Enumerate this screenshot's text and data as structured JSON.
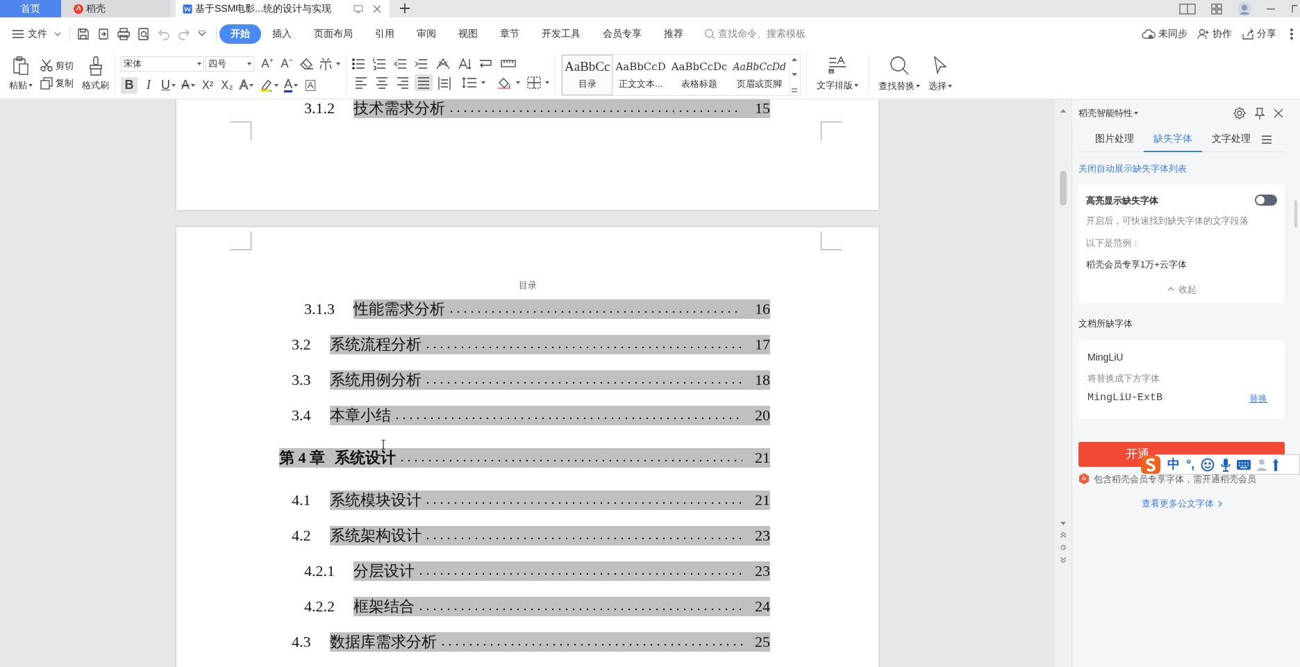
{
  "top_tabs": [
    {
      "kind": "home",
      "label": "首页",
      "selected": false
    },
    {
      "kind": "app",
      "label": "稻壳",
      "selected": false
    },
    {
      "kind": "doc",
      "label": "基于SSM电影...统的设计与实现",
      "selected": true
    }
  ],
  "menu": {
    "file": "文件",
    "tabs": [
      {
        "label": "开始",
        "selected": true
      },
      {
        "label": "插入",
        "selected": false
      },
      {
        "label": "页面布局",
        "selected": false
      },
      {
        "label": "引用",
        "selected": false
      },
      {
        "label": "审阅",
        "selected": false
      },
      {
        "label": "视图",
        "selected": false
      },
      {
        "label": "章节",
        "selected": false
      },
      {
        "label": "开发工具",
        "selected": false
      },
      {
        "label": "会员专享",
        "selected": false
      },
      {
        "label": "推荐",
        "selected": false
      }
    ],
    "search_placeholder": "查找命令、搜索模板",
    "actions": [
      {
        "kind": "sync",
        "label": "未同步"
      },
      {
        "kind": "collab",
        "label": "协作"
      },
      {
        "kind": "share",
        "label": "分享"
      }
    ]
  },
  "ribbon": {
    "paste": "粘贴",
    "cut": "剪切",
    "copy": "复制",
    "format_painter": "格式刷",
    "font": "宋体",
    "size": "四号",
    "grow": "A⁺",
    "shrink": "A⁻",
    "font_buttons": [
      {
        "kind": "bold",
        "label": "B",
        "selected": true
      },
      {
        "kind": "italic",
        "label": "I",
        "selected": false
      },
      {
        "kind": "underline",
        "label": "U",
        "selected": false
      },
      {
        "kind": "strike",
        "label": "A",
        "selected": false
      },
      {
        "kind": "sup",
        "label": "X²",
        "selected": false
      },
      {
        "kind": "sub",
        "label": "X₂",
        "selected": false
      },
      {
        "kind": "outline",
        "label": "A",
        "selected": false
      },
      {
        "kind": "highlight",
        "selected": false
      },
      {
        "kind": "color",
        "label": "A",
        "selected": false
      },
      {
        "kind": "boxed",
        "label": "A",
        "selected": false
      }
    ],
    "alignment": [
      {
        "kind": "left",
        "selected": false
      },
      {
        "kind": "center",
        "selected": false
      },
      {
        "kind": "right",
        "selected": false
      },
      {
        "kind": "justify",
        "selected": true
      },
      {
        "kind": "distribute",
        "selected": false
      }
    ],
    "styles": [
      {
        "sample": "AaBbCc",
        "label": "目录",
        "selected": true
      },
      {
        "sample": "AaBbCcD",
        "label": "正文文本...",
        "selected": false
      },
      {
        "sample": "AaBbCcDc",
        "label": "表格标题",
        "selected": false
      },
      {
        "sample": "AaBbCcDd",
        "label": "页眉或页脚",
        "selected": false
      }
    ],
    "text_layout": "文字排版",
    "find_replace": "查找替换",
    "select": "选择"
  },
  "document": {
    "pages": [
      {
        "entries": [
          {
            "kind": "subsection",
            "number": "3.1.2",
            "title": "技术需求分析",
            "page": "15"
          }
        ]
      },
      {
        "header": "目录",
        "entries": [
          {
            "kind": "subsection",
            "number": "3.1.3",
            "title": "性能需求分析",
            "page": "16"
          },
          {
            "kind": "section",
            "number": "3.2",
            "title": "系统流程分析",
            "page": "17"
          },
          {
            "kind": "section",
            "number": "3.3",
            "title": "系统用例分析",
            "page": "18"
          },
          {
            "kind": "section",
            "number": "3.4",
            "title": "本章小结",
            "page": "20"
          },
          {
            "kind": "chapter",
            "number": "第 4 章",
            "title": "系统设计",
            "page": "21"
          },
          {
            "kind": "section",
            "number": "4.1",
            "title": "系统模块设计",
            "page": "21"
          },
          {
            "kind": "section",
            "number": "4.2",
            "title": "系统架构设计",
            "page": "23"
          },
          {
            "kind": "subsection",
            "number": "4.2.1",
            "title": "分层设计",
            "page": "23"
          },
          {
            "kind": "subsection",
            "number": "4.2.2",
            "title": "框架结合",
            "page": "24"
          },
          {
            "kind": "section",
            "number": "4.3",
            "title": "数据库需求分析",
            "page": "25"
          }
        ]
      }
    ]
  },
  "panel": {
    "title": "稻壳智能特性",
    "tabs": [
      {
        "label": "图片处理",
        "selected": false
      },
      {
        "label": "缺失字体",
        "selected": true
      },
      {
        "label": "文字处理",
        "selected": false
      }
    ],
    "close_link": "关闭自动展示缺失字体列表",
    "highlight_card": {
      "title": "高亮显示缺失字体",
      "on": false,
      "description": "开启后，可快速找到缺失字体的文字段落",
      "example_label": "以下是范例：",
      "example": "稻壳会员专享1万+云字体",
      "collapse": "收起"
    },
    "missing_heading": "文档所缺字体",
    "missing_font": {
      "name": "MingLiU",
      "hint": "将替换成下方字体",
      "replacement": "MingLiU-ExtB",
      "action": "替换"
    },
    "button": "开通",
    "notice": "包含稻壳会员专享字体，需开通稻壳会员",
    "more_link": "查看更多公文字体"
  },
  "ime_bar": {
    "mode": "中",
    "punctuation": "°,"
  }
}
